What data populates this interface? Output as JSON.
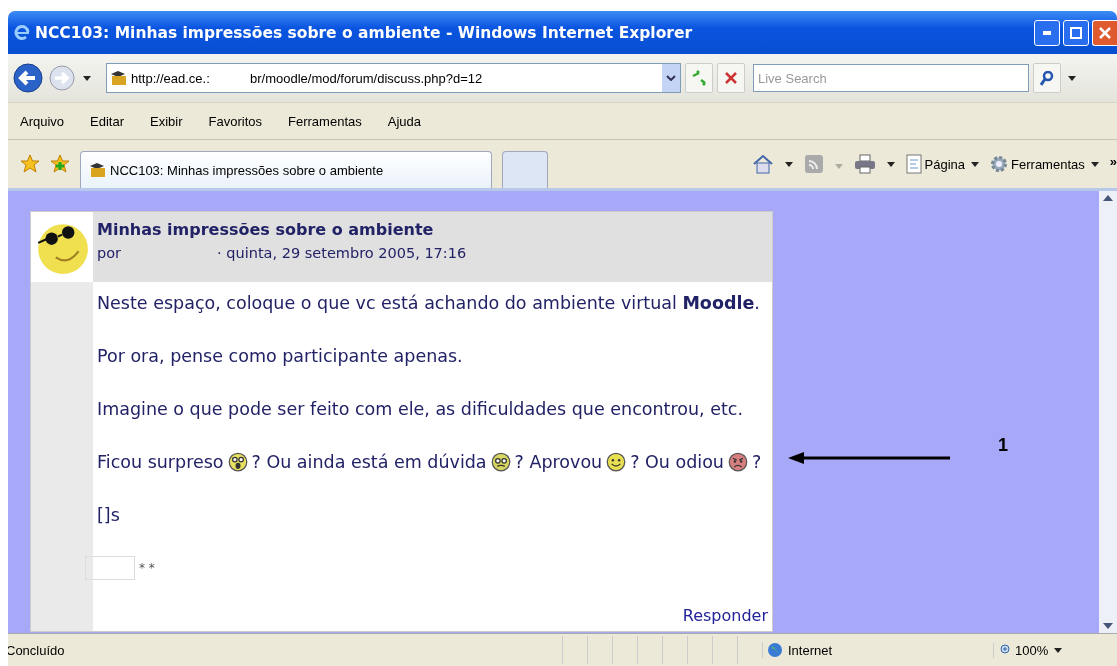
{
  "window": {
    "title": "NCC103: Minhas impressões sobre o ambiente - Windows Internet Explorer"
  },
  "address_bar": {
    "url_start": "http://ead.ce.:",
    "url_end": "br/moodle/mod/forum/discuss.php?d=12"
  },
  "search": {
    "placeholder": "Live Search"
  },
  "menu": [
    "Arquivo",
    "Editar",
    "Exibir",
    "Favoritos",
    "Ferramentas",
    "Ajuda"
  ],
  "tabs": [
    {
      "label": "NCC103: Minhas impressões sobre o ambiente",
      "selected": true
    },
    {
      "selected": false
    }
  ],
  "command_bar": {
    "page": "Página",
    "tools": "Ferramentas",
    "overflow": "»"
  },
  "post": {
    "subject": "Minhas impressões sobre o ambiente",
    "by": "por",
    "date": "· quinta, 29 setembro 2005, 17:16",
    "paragraphs": [
      [
        {
          "kind": "text",
          "text": "Neste espaço, coloque o que vc está achando do ambiente virtual **Moodle**."
        }
      ],
      [
        {
          "kind": "text",
          "text": "Por ora, pense como participante apenas."
        }
      ],
      [
        {
          "kind": "text",
          "text": "Imagine o que pode ser feito com ele, as dificuldades que encontrou, etc."
        }
      ],
      [
        {
          "kind": "text",
          "text": "Ficou surpreso"
        },
        {
          "kind": "surprised"
        },
        {
          "kind": "text",
          "text": "? Ou ainda está em dúvida"
        },
        {
          "kind": "confused"
        },
        {
          "kind": "text",
          "text": "? Aprovou"
        },
        {
          "kind": "smile"
        },
        {
          "kind": "text",
          "text": "? Ou odiou"
        },
        {
          "kind": "angry"
        },
        {
          "kind": "text",
          "text": "?"
        }
      ],
      [
        {
          "kind": "text",
          "text": "[]s"
        }
      ],
      [
        {
          "kind": "signature",
          "text": "* *"
        }
      ]
    ],
    "reply": "Responder"
  },
  "annotation": {
    "label": "1"
  },
  "status_bar": {
    "text": "Concluído",
    "zone": "Internet",
    "zoom": "100%"
  }
}
